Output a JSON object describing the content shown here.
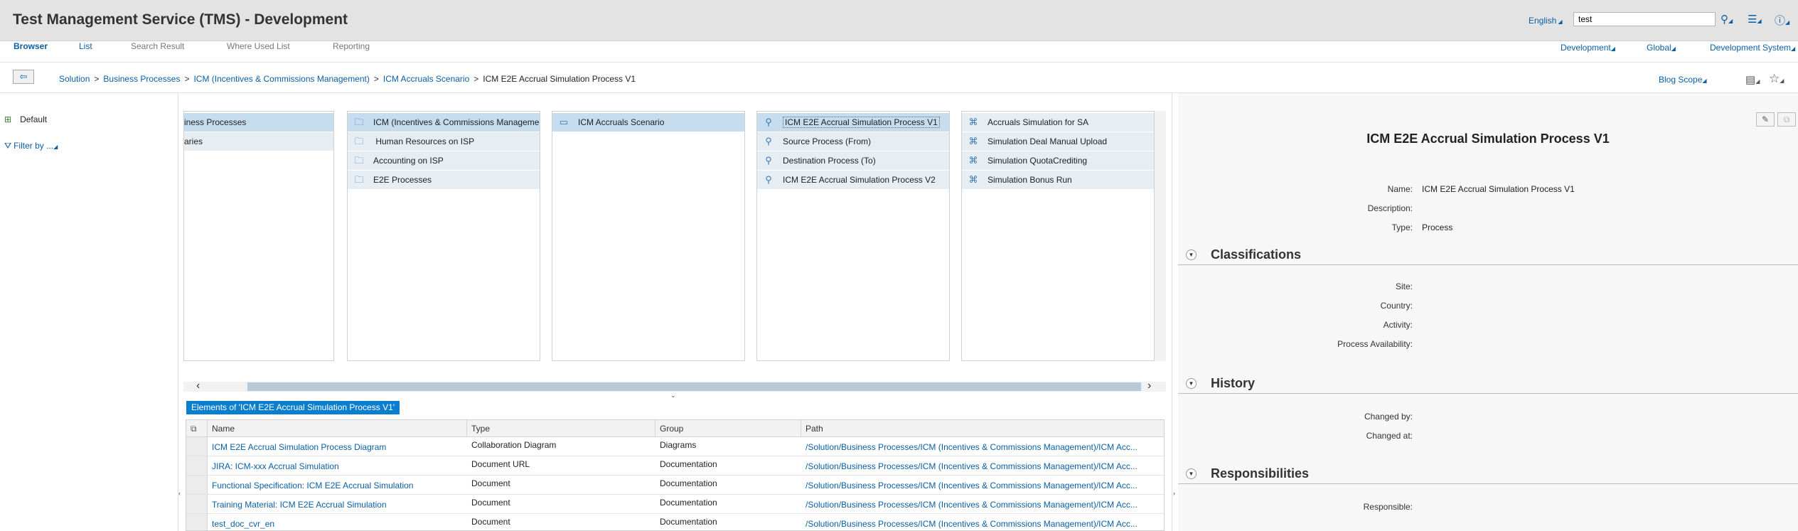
{
  "header": {
    "title": "Test Management Service (TMS) - Development",
    "language": "English",
    "search_value": "test",
    "icons": [
      "binoculars-icon",
      "list-icon",
      "help-icon"
    ]
  },
  "tabs": {
    "left": [
      {
        "label": "Browser",
        "active": true
      },
      {
        "label": "List",
        "active": false
      },
      {
        "label": "Search Result",
        "active": false
      },
      {
        "label": "Where Used List",
        "active": false
      },
      {
        "label": "Reporting",
        "active": false
      }
    ],
    "right": [
      {
        "label": "Development"
      },
      {
        "label": "Global"
      },
      {
        "label": "Development System"
      }
    ]
  },
  "breadcrumb": {
    "items": [
      "Solution",
      "Business Processes",
      "ICM (Incentives & Commissions Management)",
      "ICM Accruals Scenario"
    ],
    "current": "ICM E2E Accrual Simulation Process  V1",
    "separator": ">",
    "blog_scope": "Blog Scope"
  },
  "left_panel": {
    "variant": "Default",
    "filter": "Filter by ..."
  },
  "browser": {
    "columns": [
      {
        "items": [
          {
            "label": "iness Processes",
            "state": "selected"
          },
          {
            "label": "aries",
            "state": "highlight"
          }
        ]
      },
      {
        "items": [
          {
            "label": "ICM (Incentives & Commissions Management)",
            "icon": "folder-icon",
            "state": "selected"
          },
          {
            "label": "Human Resources on ISP",
            "icon": "folder-icon",
            "state": "highlight"
          },
          {
            "label": "Accounting on ISP",
            "icon": "folder-icon",
            "state": "highlight"
          },
          {
            "label": "E2E Processes",
            "icon": "folder-icon",
            "state": "highlight"
          }
        ]
      },
      {
        "items": [
          {
            "label": "ICM Accruals Scenario",
            "icon": "scenario-icon",
            "state": "selected"
          }
        ]
      },
      {
        "items": [
          {
            "label": "ICM E2E Accrual Simulation Process  V1",
            "icon": "process-icon",
            "state": "selected"
          },
          {
            "label": "Source Process (From)",
            "icon": "process-icon",
            "state": "highlight"
          },
          {
            "label": "Destination Process (To)",
            "icon": "process-icon",
            "state": "highlight"
          },
          {
            "label": "ICM E2E Accrual Simulation Process V2",
            "icon": "process-icon",
            "state": "highlight"
          }
        ]
      },
      {
        "items": [
          {
            "label": "Accruals Simulation for SA",
            "icon": "step-icon",
            "state": "highlight"
          },
          {
            "label": "Simulation Deal Manual Upload",
            "icon": "step-icon",
            "state": "highlight"
          },
          {
            "label": "Simulation QuotaCrediting",
            "icon": "step-icon",
            "state": "highlight"
          },
          {
            "label": "Simulation Bonus Run",
            "icon": "step-icon",
            "state": "highlight"
          }
        ]
      }
    ]
  },
  "elements": {
    "title": "Elements of 'ICM E2E Accrual Simulation Process V1'",
    "columns": [
      "Name",
      "Type",
      "Group",
      "Path"
    ],
    "rows": [
      {
        "name": "ICM E2E Accrual Simulation Process Diagram",
        "type": "Collaboration Diagram",
        "group": "Diagrams",
        "path": "/Solution/Business Processes/ICM (Incentives & Commissions Management)/ICM Acc..."
      },
      {
        "name": "JIRA: ICM-xxx Accrual Simulation",
        "type": "Document URL",
        "group": "Documentation",
        "path": "/Solution/Business Processes/ICM (Incentives & Commissions Management)/ICM Acc..."
      },
      {
        "name": "Functional Specification: ICM E2E Accrual Simulation",
        "type": "Document",
        "group": "Documentation",
        "path": "/Solution/Business Processes/ICM (Incentives & Commissions Management)/ICM Acc..."
      },
      {
        "name": "Training Material: ICM E2E Accrual Simulation",
        "type": "Document",
        "group": "Documentation",
        "path": "/Solution/Business Processes/ICM (Incentives & Commissions Management)/ICM Acc..."
      },
      {
        "name": "test_doc_cvr_en",
        "type": "Document",
        "group": "Documentation",
        "path": "/Solution/Business Processes/ICM (Incentives & Commissions Management)/ICM Acc..."
      }
    ]
  },
  "detail": {
    "title": "ICM E2E Accrual Simulation Process  V1",
    "fields": {
      "name_label": "Name:",
      "name_value": "ICM E2E Accrual Simulation Process  V1",
      "description_label": "Description:",
      "type_label": "Type:",
      "type_value": "Process"
    },
    "classifications": {
      "title": "Classifications",
      "site": "Site:",
      "country": "Country:",
      "activity": "Activity:",
      "availability": "Process Availability:"
    },
    "history": {
      "title": "History",
      "changed_by": "Changed by:",
      "changed_at": "Changed at:"
    },
    "responsibilities": {
      "title": "Responsibilities",
      "responsible": "Responsible:"
    }
  }
}
